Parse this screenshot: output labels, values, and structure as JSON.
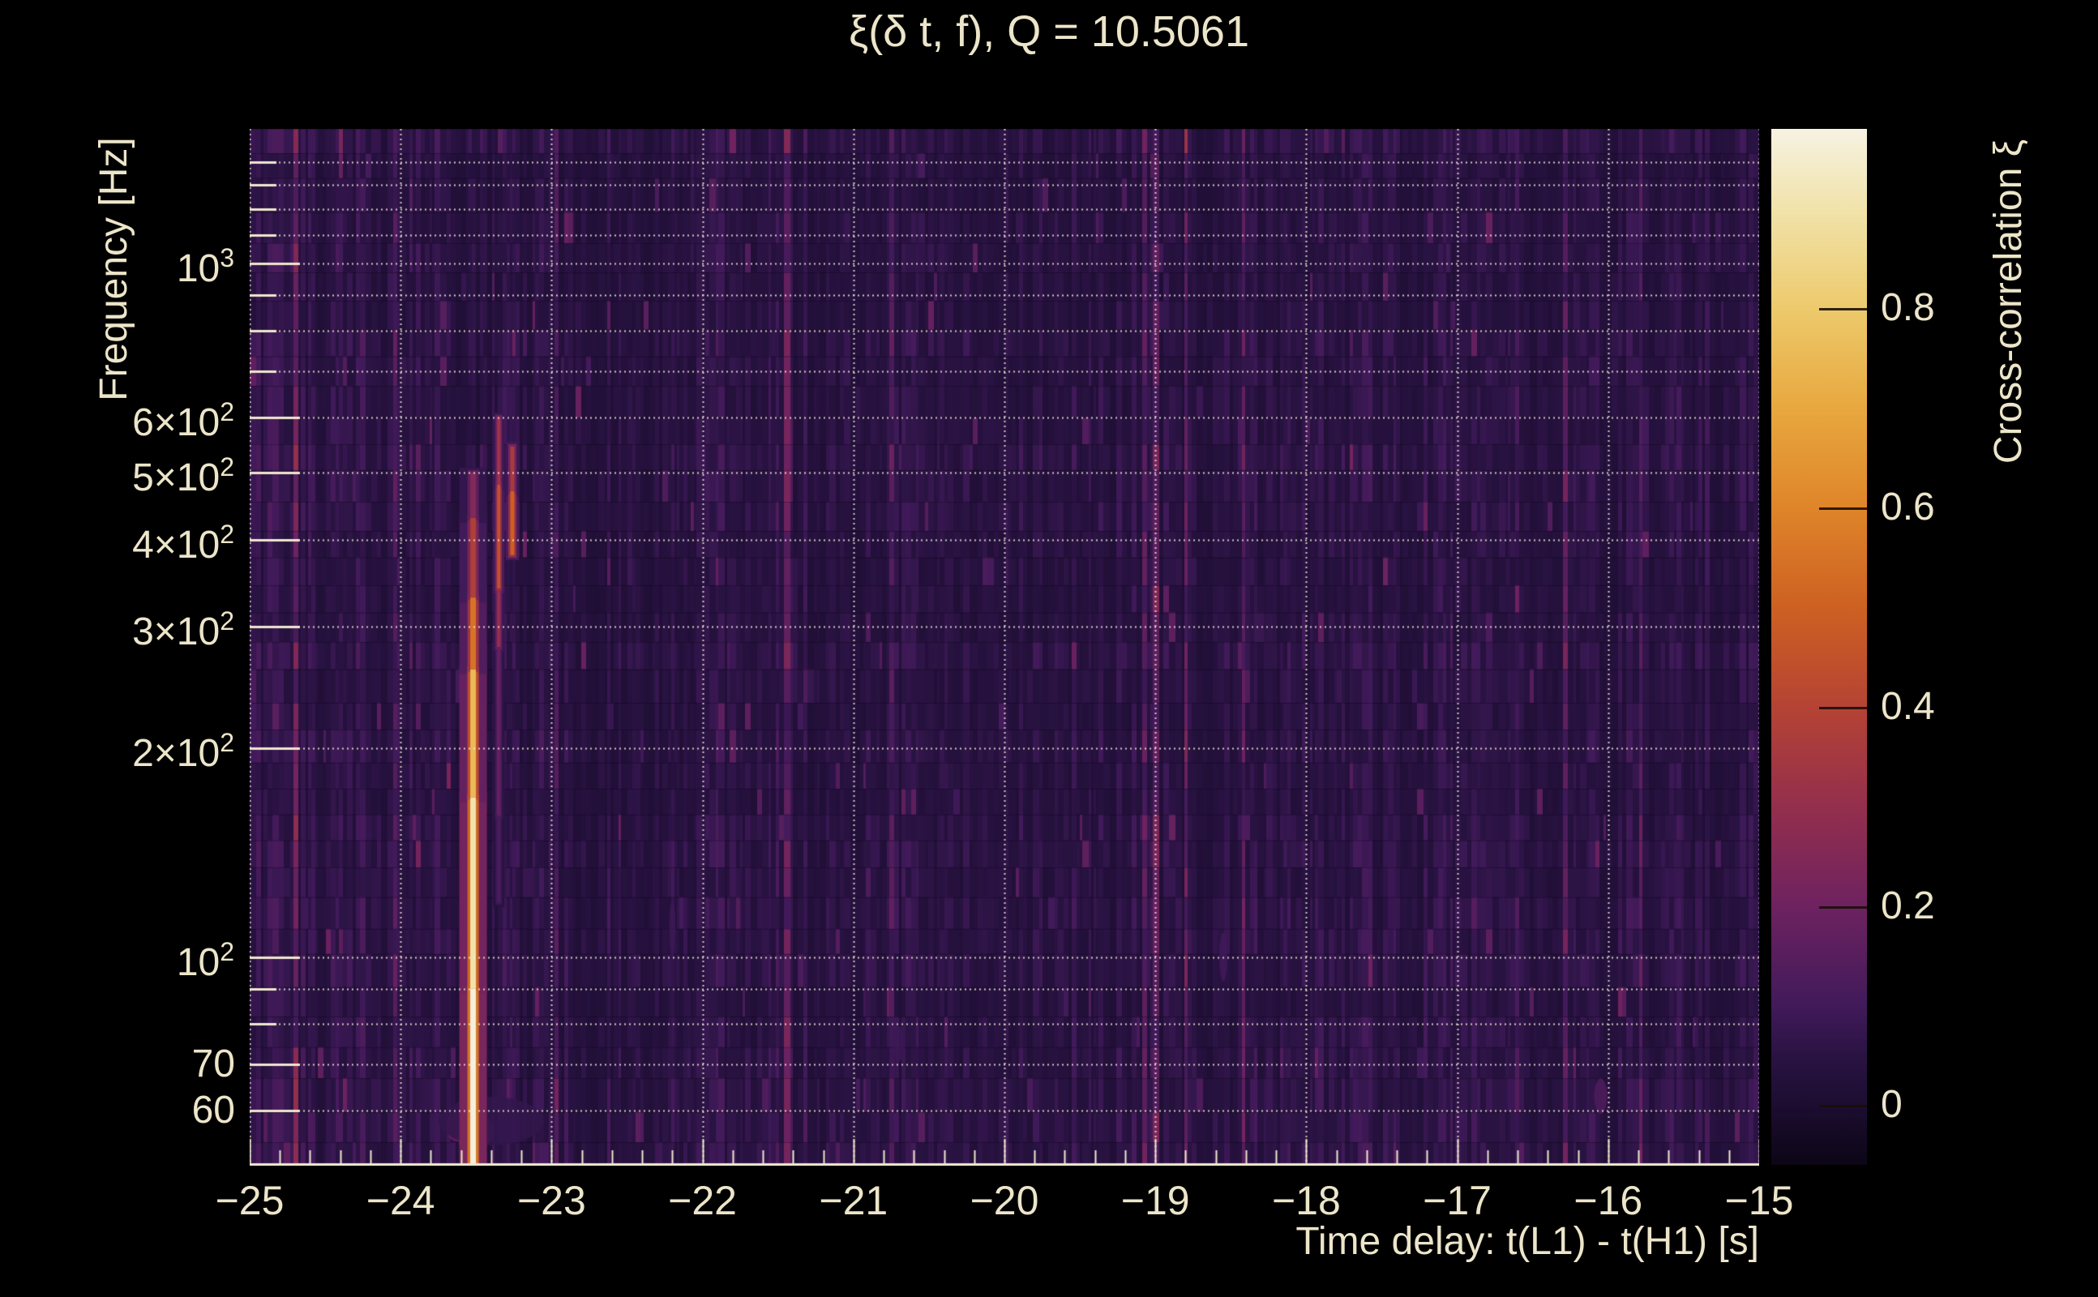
{
  "colors": {
    "background": "#000000",
    "text": "#ece5c9",
    "axis": "#efe8cf",
    "plot_background": "#1c0d31",
    "gridline": "#f3eedc"
  },
  "chart_data": {
    "type": "heatmap",
    "title": "ξ(δ t, f), Q = 10.5061",
    "xlabel": "Time delay: t(L1) - t(H1) [s]",
    "ylabel": "Frequency [Hz]",
    "colorbar_label": "Cross-correlation ξ",
    "x_range": [
      -25,
      -15
    ],
    "y_range_hz": [
      50,
      1565
    ],
    "y_scale": "log",
    "grid": true,
    "colorbar_range": [
      -0.06,
      0.98
    ],
    "colorbar_ticks": [
      {
        "v": 0.8,
        "label": "0.8"
      },
      {
        "v": 0.6,
        "label": "0.6"
      },
      {
        "v": 0.4,
        "label": "0.4"
      },
      {
        "v": 0.2,
        "label": "0.2"
      },
      {
        "v": 0,
        "label": "0"
      }
    ],
    "x_ticks": [
      {
        "v": -25,
        "label": "−25"
      },
      {
        "v": -24,
        "label": "−24"
      },
      {
        "v": -23,
        "label": "−23"
      },
      {
        "v": -22,
        "label": "−22"
      },
      {
        "v": -21,
        "label": "−21"
      },
      {
        "v": -20,
        "label": "−20"
      },
      {
        "v": -19,
        "label": "−19"
      },
      {
        "v": -18,
        "label": "−18"
      },
      {
        "v": -17,
        "label": "−17"
      },
      {
        "v": -16,
        "label": "−16"
      },
      {
        "v": -15,
        "label": "−15"
      }
    ],
    "x_minor_step": 0.2,
    "y_ticks": [
      {
        "v": 1000,
        "base": "10",
        "exp": "3"
      },
      {
        "v": 600,
        "base": "6×10",
        "exp": "2"
      },
      {
        "v": 500,
        "base": "5×10",
        "exp": "2"
      },
      {
        "v": 400,
        "base": "4×10",
        "exp": "2"
      },
      {
        "v": 300,
        "base": "3×10",
        "exp": "2"
      },
      {
        "v": 200,
        "base": "2×10",
        "exp": "2"
      },
      {
        "v": 100,
        "base": "10",
        "exp": "2"
      },
      {
        "v": 70,
        "base": "70",
        "exp": ""
      },
      {
        "v": 60,
        "base": "60",
        "exp": ""
      }
    ],
    "y_gridlines_minor": [
      1400,
      1300,
      1200,
      1100,
      900,
      800,
      700,
      90,
      80
    ],
    "palette": [
      [
        -0.06,
        "#0c0616"
      ],
      [
        0,
        "#1c0d31"
      ],
      [
        0.05,
        "#2a1343"
      ],
      [
        0.1,
        "#411a5a"
      ],
      [
        0.2,
        "#6e2260"
      ],
      [
        0.3,
        "#942f4d"
      ],
      [
        0.4,
        "#b54334"
      ],
      [
        0.5,
        "#cd6122"
      ],
      [
        0.6,
        "#df852a"
      ],
      [
        0.7,
        "#e8a83f"
      ],
      [
        0.8,
        "#edca6c"
      ],
      [
        0.9,
        "#f1e3ab"
      ],
      [
        0.98,
        "#f6f2e2"
      ]
    ],
    "features": {
      "streaks": [
        {
          "t": -23.52,
          "core_w": 7,
          "mid_w": 14,
          "glow_w": 34,
          "segments": [
            {
              "f0": 50,
              "f1": 90,
              "v": 0.97
            },
            {
              "f0": 90,
              "f1": 170,
              "v": 0.9
            },
            {
              "f0": 170,
              "f1": 260,
              "v": 0.75
            },
            {
              "f0": 260,
              "f1": 330,
              "v": 0.55
            },
            {
              "f0": 330,
              "f1": 430,
              "v": 0.38
            },
            {
              "f0": 430,
              "f1": 500,
              "v": 0.25
            }
          ]
        },
        {
          "t": -23.35,
          "core_w": 4,
          "mid_w": 8,
          "glow_w": 14,
          "segments": [
            {
              "f0": 120,
              "f1": 160,
              "v": 0.12
            },
            {
              "f0": 160,
              "f1": 280,
              "v": 0.18
            },
            {
              "f0": 280,
              "f1": 340,
              "v": 0.3
            },
            {
              "f0": 340,
              "f1": 480,
              "v": 0.45
            },
            {
              "f0": 480,
              "f1": 600,
              "v": 0.33
            }
          ]
        },
        {
          "t": -23.26,
          "core_w": 5,
          "mid_w": 10,
          "glow_w": 16,
          "segments": [
            {
              "f0": 380,
              "f1": 470,
              "v": 0.5
            },
            {
              "f0": 470,
              "f1": 545,
              "v": 0.36
            }
          ]
        }
      ],
      "blobs": [
        {
          "t": -23.52,
          "f": 54,
          "w": 34,
          "h": 44,
          "v": 0.5
        },
        {
          "t": -23.63,
          "f": 57,
          "w": 26,
          "h": 38,
          "v": 0.17
        },
        {
          "t": -23.44,
          "f": 56,
          "w": 22,
          "h": 32,
          "v": 0.15
        },
        {
          "t": -23.4,
          "f": 58,
          "w": 130,
          "h": 60,
          "v": 0.07
        },
        {
          "t": -16.05,
          "f": 63,
          "w": 16,
          "h": 44,
          "v": 0.13
        },
        {
          "t": -18.55,
          "f": 100,
          "w": 10,
          "h": 60,
          "v": 0.1
        },
        {
          "t": -20.7,
          "f": 75,
          "w": 12,
          "h": 44,
          "v": 0.09
        },
        {
          "t": -22.2,
          "f": 110,
          "w": 8,
          "h": 70,
          "v": 0.09
        }
      ]
    },
    "noise": {
      "seed": 7,
      "col_w_min": 3,
      "col_w_max": 8,
      "row_h_min": 30,
      "row_h_max": 42,
      "base_min": 0.018,
      "base_var": 0.05,
      "bright_prob": 0.045,
      "spike_prob": 0.015
    }
  }
}
